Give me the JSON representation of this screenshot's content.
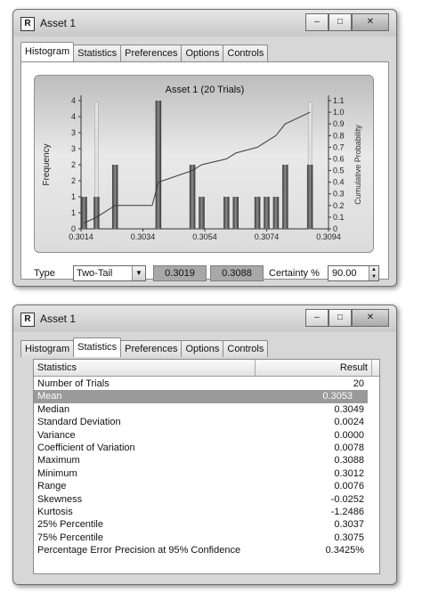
{
  "win1": {
    "title": "Asset 1",
    "tabs": [
      "Histogram",
      "Statistics",
      "Preferences",
      "Options",
      "Controls"
    ],
    "active_tab": "Histogram"
  },
  "chart_data": {
    "type": "bar",
    "title": "Asset 1 (20 Trials)",
    "ylabel": "Frequency",
    "y2label": "Cumulative Probability",
    "xticks": [
      "0.3014",
      "0.3034",
      "0.3054",
      "0.3074",
      "0.3094"
    ],
    "xlim": [
      0.3014,
      0.3094
    ],
    "ylim": [
      0,
      4
    ],
    "yticks": [
      "0",
      "1",
      "1",
      "2",
      "2",
      "3",
      "3",
      "4",
      "4"
    ],
    "y2lim": [
      0,
      1.1
    ],
    "y2ticks": [
      "0",
      "0.1",
      "0.2",
      "0.3",
      "0.4",
      "0.5",
      "0.6",
      "0.7",
      "0.8",
      "0.9",
      "1.0",
      "1.1"
    ],
    "bars": [
      {
        "x": 0.3015,
        "value": 1
      },
      {
        "x": 0.3019,
        "value": 1
      },
      {
        "x": 0.3025,
        "value": 2
      },
      {
        "x": 0.3039,
        "value": 4
      },
      {
        "x": 0.305,
        "value": 2
      },
      {
        "x": 0.3053,
        "value": 1
      },
      {
        "x": 0.3061,
        "value": 1
      },
      {
        "x": 0.3064,
        "value": 1
      },
      {
        "x": 0.3071,
        "value": 1
      },
      {
        "x": 0.3074,
        "value": 1
      },
      {
        "x": 0.3077,
        "value": 1
      },
      {
        "x": 0.308,
        "value": 2
      },
      {
        "x": 0.3088,
        "value": 2
      }
    ],
    "certainty_markers": [
      0.3019,
      0.3088
    ],
    "cumulative": [
      {
        "x": 0.3015,
        "y": 0.05
      },
      {
        "x": 0.3019,
        "y": 0.1
      },
      {
        "x": 0.3025,
        "y": 0.2
      },
      {
        "x": 0.3037,
        "y": 0.2
      },
      {
        "x": 0.3039,
        "y": 0.4
      },
      {
        "x": 0.305,
        "y": 0.5
      },
      {
        "x": 0.3053,
        "y": 0.55
      },
      {
        "x": 0.3061,
        "y": 0.6
      },
      {
        "x": 0.3064,
        "y": 0.65
      },
      {
        "x": 0.3071,
        "y": 0.7
      },
      {
        "x": 0.3074,
        "y": 0.75
      },
      {
        "x": 0.3077,
        "y": 0.8
      },
      {
        "x": 0.308,
        "y": 0.9
      },
      {
        "x": 0.3088,
        "y": 1.0
      }
    ]
  },
  "controls": {
    "type_label": "Type",
    "type_value": "Two-Tail",
    "low_value": "0.3019",
    "high_value": "0.3088",
    "certainty_label": "Certainty %",
    "certainty_value": "90.00"
  },
  "win2": {
    "title": "Asset 1",
    "tabs": [
      "Histogram",
      "Statistics",
      "Preferences",
      "Options",
      "Controls"
    ],
    "active_tab": "Statistics",
    "col_stat": "Statistics",
    "col_result": "Result",
    "rows": [
      {
        "name": "Number of Trials",
        "result": "20"
      },
      {
        "name": "Mean",
        "result": "0.3053"
      },
      {
        "name": "Median",
        "result": "0.3049"
      },
      {
        "name": "Standard Deviation",
        "result": "0.0024"
      },
      {
        "name": "Variance",
        "result": "0.0000"
      },
      {
        "name": "Coefficient of Variation",
        "result": "0.0078"
      },
      {
        "name": "Maximum",
        "result": "0.3088"
      },
      {
        "name": "Minimum",
        "result": "0.3012"
      },
      {
        "name": "Range",
        "result": "0.0076"
      },
      {
        "name": "Skewness",
        "result": "-0.0252"
      },
      {
        "name": "Kurtosis",
        "result": "-1.2486"
      },
      {
        "name": "25% Percentile",
        "result": "0.3037"
      },
      {
        "name": "75% Percentile",
        "result": "0.3075"
      },
      {
        "name": "Percentage Error Precision at 95% Confidence",
        "result": "0.3425%"
      }
    ],
    "selected_row": 1
  }
}
